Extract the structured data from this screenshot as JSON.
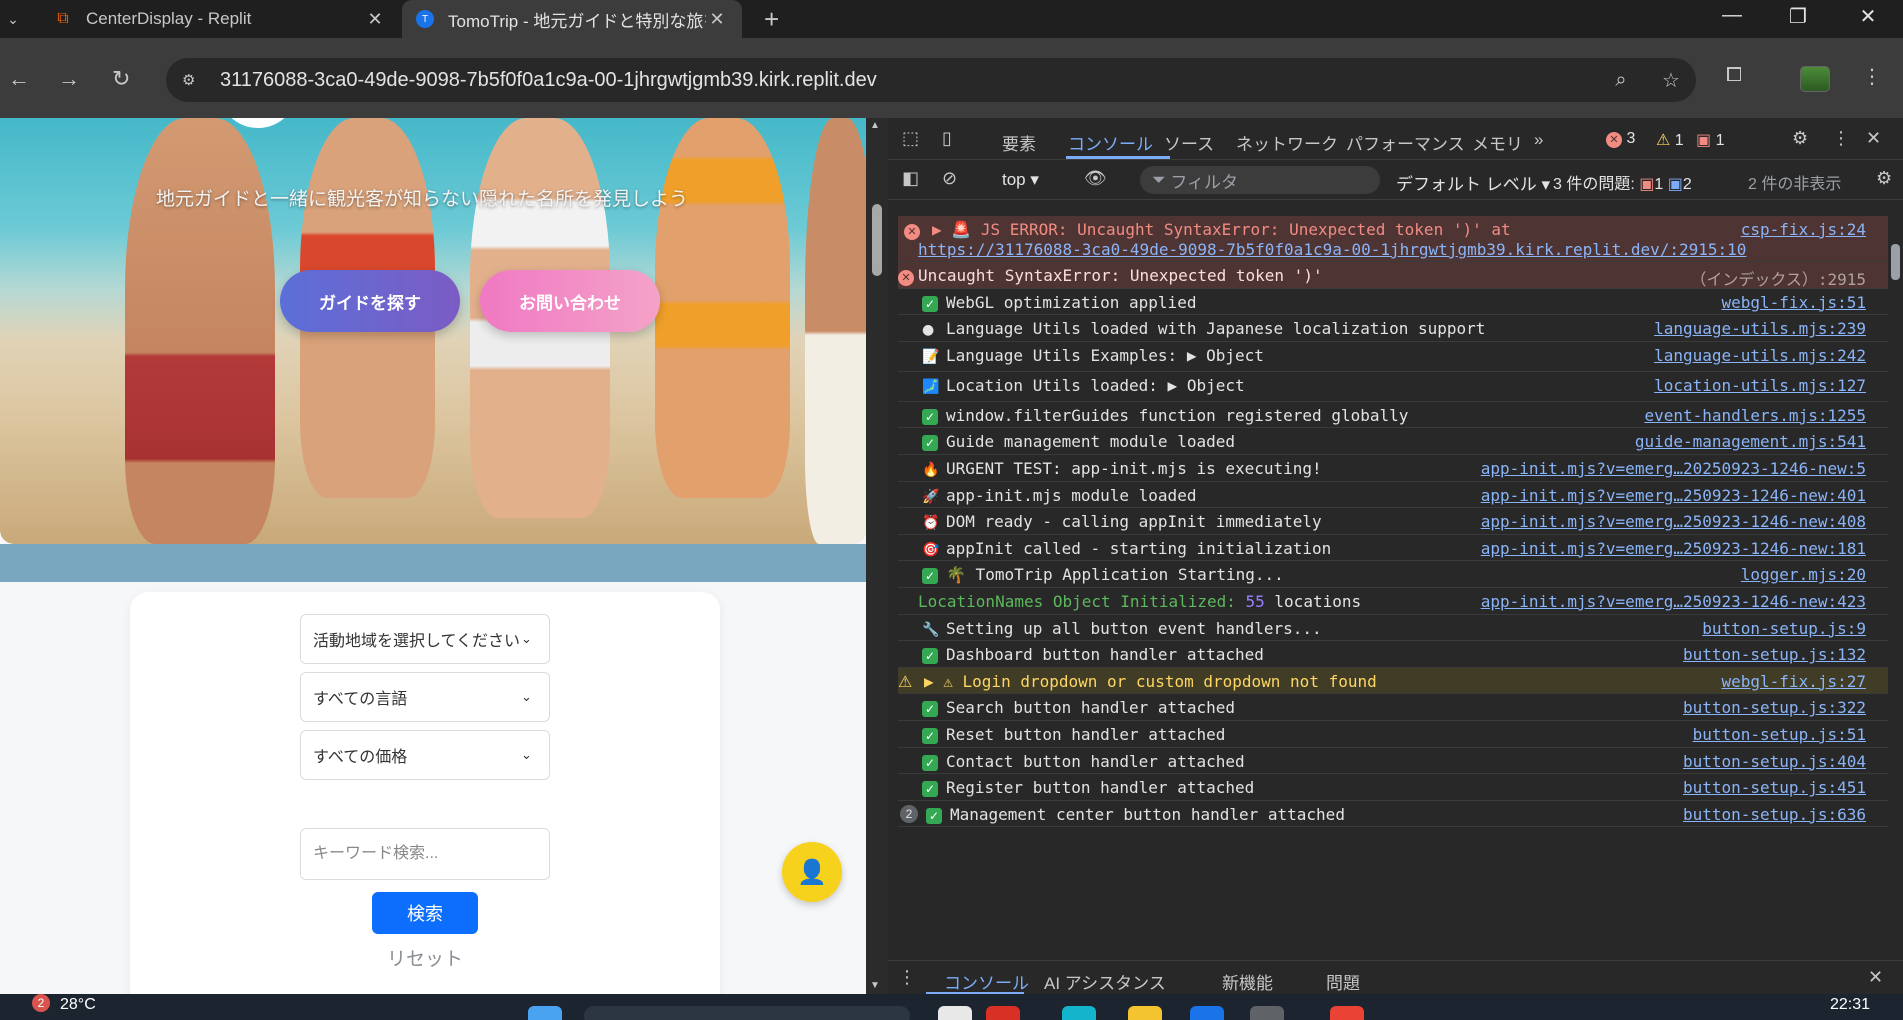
{
  "browser": {
    "tabs": [
      {
        "title": "CenterDisplay - Replit",
        "icon": "replit-icon",
        "active": false
      },
      {
        "title": "TomoTrip - 地元ガイドと特別な旅を",
        "icon": "tomotrip-icon",
        "active": true
      }
    ],
    "url": "31176088-3ca0-49de-9098-7b5f0f0a1c9a-00-1jhrgwtjgmb39.kirk.replit.dev"
  },
  "page": {
    "hero_subtitle": "地元ガイドと一緒に観光客が知らない隠れた名所を発見しよう",
    "find_guide_label": "ガイドを探す",
    "contact_label": "お問い合わせ",
    "search": {
      "region_value": "活動地域を選択してください",
      "language_value": "すべての言語",
      "price_value": "すべての価格",
      "keyword_placeholder": "キーワード検索...",
      "search_label": "検索",
      "reset_label": "リセット"
    }
  },
  "devtools": {
    "tabs": [
      "要素",
      "コンソール",
      "ソース",
      "ネットワーク",
      "パフォーマンス",
      "メモリ"
    ],
    "active_tab": "コンソール",
    "counts": {
      "errors": "3",
      "warnings": "1",
      "issues": "1"
    },
    "context": "top",
    "filter_placeholder": "フィルタ",
    "level": "デフォルト レベル",
    "issues_label": "3 件の問題:",
    "issues_errors": "1",
    "issues_info": "2",
    "hidden_label": "2 件の非表示",
    "drawer_tabs": [
      "コンソール",
      "AI アシスタンス",
      "新機能",
      "問題"
    ],
    "logs": [
      {
        "type": "error",
        "text": "▶ 🚨 JS ERROR: Uncaught SyntaxError: Unexpected token ')' at",
        "text2": "https://31176088-3ca0-49de-9098-7b5f0f0a1c9a-00-1jhrgwtjgmb39.kirk.replit.dev/:2915:10",
        "src": "csp-fix.js:24"
      },
      {
        "type": "error2",
        "text": "Uncaught SyntaxError: Unexpected token ')'",
        "src": "（インデックス）:2915"
      },
      {
        "type": "check",
        "text": "WebGL optimization applied",
        "src": "webgl-fix.js:51"
      },
      {
        "type": "emoji",
        "icon": "●",
        "text": "Language Utils loaded with Japanese localization support",
        "src": "language-utils.mjs:239"
      },
      {
        "type": "emoji",
        "icon": "📝",
        "text": "Language Utils Examples:  ▶ Object",
        "src": "language-utils.mjs:242"
      },
      {
        "type": "emoji",
        "icon": "🗾",
        "text": "Location Utils loaded:  ▶ Object",
        "src": "location-utils.mjs:127"
      },
      {
        "type": "check",
        "text": "window.filterGuides function registered globally",
        "src": "event-handlers.mjs:1255"
      },
      {
        "type": "check",
        "text": "Guide management module loaded",
        "src": "guide-management.mjs:541"
      },
      {
        "type": "emoji",
        "icon": "🔥",
        "text": "URGENT TEST: app-init.mjs is executing!",
        "src": "app-init.mjs?v=emerg…20250923-1246-new:5"
      },
      {
        "type": "emoji",
        "icon": "🚀",
        "text": "app-init.mjs module loaded",
        "src": "app-init.mjs?v=emerg…250923-1246-new:401"
      },
      {
        "type": "emoji",
        "icon": "⏰",
        "text": "DOM ready - calling appInit immediately",
        "src": "app-init.mjs?v=emerg…250923-1246-new:408"
      },
      {
        "type": "emoji",
        "icon": "🎯",
        "text": "appInit called - starting initialization",
        "src": "app-init.mjs?v=emerg…250923-1246-new:181"
      },
      {
        "type": "check",
        "text": "🌴 TomoTrip Application Starting...",
        "src": "logger.mjs:20"
      },
      {
        "type": "plain",
        "text": "LocationNames Object Initialized: ",
        "num": "55",
        "tail": " locations",
        "src": "app-init.mjs?v=emerg…250923-1246-new:423"
      },
      {
        "type": "emoji",
        "icon": "🔧",
        "text": "Setting up all button event handlers...",
        "src": "button-setup.js:9"
      },
      {
        "type": "check",
        "text": "Dashboard button handler attached",
        "src": "button-setup.js:132"
      },
      {
        "type": "warn",
        "text": "▶ ⚠ Login dropdown or custom dropdown not found",
        "src": "webgl-fix.js:27"
      },
      {
        "type": "check",
        "text": "Search button handler attached",
        "src": "button-setup.js:322"
      },
      {
        "type": "check",
        "text": "Reset button handler attached",
        "src": "button-setup.js:51"
      },
      {
        "type": "check",
        "text": "Contact button handler attached",
        "src": "button-setup.js:404"
      },
      {
        "type": "check",
        "text": "Register button handler attached",
        "src": "button-setup.js:451"
      },
      {
        "type": "check",
        "count": "2",
        "text": "Management center button handler attached",
        "src": "button-setup.js:636"
      }
    ]
  },
  "taskbar": {
    "weather": "28°C",
    "notification_count": "2",
    "clock": "22:31"
  }
}
